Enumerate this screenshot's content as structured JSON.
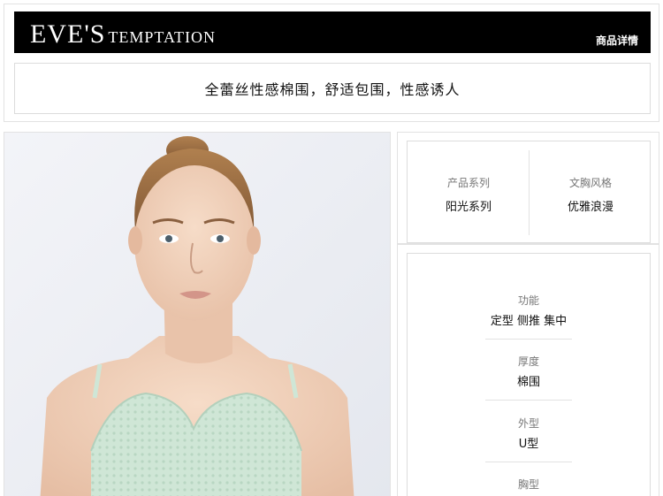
{
  "header": {
    "logo_main": "EVE'S",
    "logo_sub": "TEMPTATION",
    "detail_link": "商品详情",
    "tagline": "全蕾丝性感棉围，舒适包围，性感诱人"
  },
  "product_photo": {
    "alt": "model wearing mint-green lace bra"
  },
  "attributes": [
    {
      "label": "产品系列",
      "value": "阳光系列"
    },
    {
      "label": "文胸风格",
      "value": "优雅浪漫"
    }
  ],
  "specs": [
    {
      "label": "功能",
      "value": "定型 侧推 集中"
    },
    {
      "label": "厚度",
      "value": "棉围"
    },
    {
      "label": "外型",
      "value": "U型"
    },
    {
      "label": "胸型",
      "value": ""
    }
  ],
  "colors": {
    "banner_bg": "#000000",
    "bra_mint": "#cfe6d6",
    "skin": "#f0d2bd",
    "hair": "#9a6a44",
    "photo_bg": "#eef0f4"
  }
}
